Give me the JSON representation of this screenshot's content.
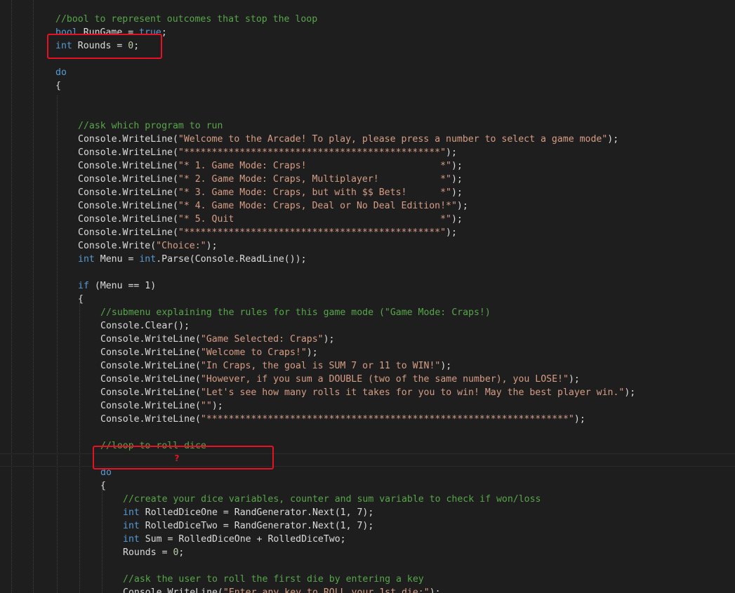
{
  "editor": {
    "theme": {
      "background": "#1e1e1e",
      "keyword": "#569cd6",
      "string": "#d69d85",
      "comment": "#57a64a",
      "number": "#b5cea8",
      "plain": "#dcdcdc",
      "highlight_box": "#e81123"
    },
    "lines": [
      [
        [
          "cm",
          "//bool to represent outcomes that stop the loop"
        ]
      ],
      [
        [
          "kw",
          "bool"
        ],
        [
          "pl",
          " RunGame = "
        ],
        [
          "kw",
          "true"
        ],
        [
          "pl",
          ";"
        ]
      ],
      [
        [
          "kw",
          "int"
        ],
        [
          "pl",
          " Rounds = "
        ],
        [
          "num",
          "0"
        ],
        [
          "pl",
          ";"
        ]
      ],
      [],
      [
        [
          "kw",
          "do"
        ]
      ],
      [
        [
          "pl",
          "{"
        ]
      ],
      [],
      [],
      [
        [
          "cm",
          "//ask which program to run"
        ]
      ],
      [
        [
          "pl",
          "Console.WriteLine("
        ],
        [
          "str",
          "\"Welcome to the Arcade! To play, please press a number to select a game mode\""
        ],
        [
          "pl",
          ");"
        ]
      ],
      [
        [
          "pl",
          "Console.WriteLine("
        ],
        [
          "str",
          "\"**********************************************\""
        ],
        [
          "pl",
          ");"
        ]
      ],
      [
        [
          "pl",
          "Console.WriteLine("
        ],
        [
          "str",
          "\"* 1. Game Mode: Craps!                        *\""
        ],
        [
          "pl",
          ");"
        ]
      ],
      [
        [
          "pl",
          "Console.WriteLine("
        ],
        [
          "str",
          "\"* 2. Game Mode: Craps, Multiplayer!           *\""
        ],
        [
          "pl",
          ");"
        ]
      ],
      [
        [
          "pl",
          "Console.WriteLine("
        ],
        [
          "str",
          "\"* 3. Game Mode: Craps, but with $$ Bets!      *\""
        ],
        [
          "pl",
          ");"
        ]
      ],
      [
        [
          "pl",
          "Console.WriteLine("
        ],
        [
          "str",
          "\"* 4. Game Mode: Craps, Deal or No Deal Edition!*\""
        ],
        [
          "pl",
          ");"
        ]
      ],
      [
        [
          "pl",
          "Console.WriteLine("
        ],
        [
          "str",
          "\"* 5. Quit                                     *\""
        ],
        [
          "pl",
          ");"
        ]
      ],
      [
        [
          "pl",
          "Console.WriteLine("
        ],
        [
          "str",
          "\"**********************************************\""
        ],
        [
          "pl",
          ");"
        ]
      ],
      [
        [
          "pl",
          "Console.Write("
        ],
        [
          "str",
          "\"Choice:\""
        ],
        [
          "pl",
          ");"
        ]
      ],
      [
        [
          "kw",
          "int"
        ],
        [
          "pl",
          " Menu = "
        ],
        [
          "kw",
          "int"
        ],
        [
          "pl",
          ".Parse(Console.ReadLine());"
        ]
      ],
      [],
      [
        [
          "kw",
          "if"
        ],
        [
          "pl",
          " (Menu == 1)"
        ]
      ],
      [
        [
          "pl",
          "{"
        ]
      ],
      [
        [
          "cm",
          "//submenu explaining the rules for this game mode (\"Game Mode: Craps!)"
        ]
      ],
      [
        [
          "pl",
          "Console.Clear();"
        ]
      ],
      [
        [
          "pl",
          "Console.WriteLine("
        ],
        [
          "str",
          "\"Game Selected: Craps\""
        ],
        [
          "pl",
          ");"
        ]
      ],
      [
        [
          "pl",
          "Console.WriteLine("
        ],
        [
          "str",
          "\"Welcome to Craps!\""
        ],
        [
          "pl",
          ");"
        ]
      ],
      [
        [
          "pl",
          "Console.WriteLine("
        ],
        [
          "str",
          "\"In Craps, the goal is SUM 7 or 11 to WIN!\""
        ],
        [
          "pl",
          ");"
        ]
      ],
      [
        [
          "pl",
          "Console.WriteLine("
        ],
        [
          "str",
          "\"However, if you sum a DOUBLE (two of the same number), you LOSE!\""
        ],
        [
          "pl",
          ");"
        ]
      ],
      [
        [
          "pl",
          "Console.WriteLine("
        ],
        [
          "str",
          "\"Let's see how many rolls it takes for you to win! May the best player win.\""
        ],
        [
          "pl",
          ");"
        ]
      ],
      [
        [
          "pl",
          "Console.WriteLine("
        ],
        [
          "str",
          "\"\""
        ],
        [
          "pl",
          ");"
        ]
      ],
      [
        [
          "pl",
          "Console.WriteLine("
        ],
        [
          "str",
          "\"*****************************************************************\""
        ],
        [
          "pl",
          ");"
        ]
      ],
      [],
      [
        [
          "cm",
          "//loop to roll dice"
        ]
      ],
      [],
      [
        [
          "kw",
          "do"
        ]
      ],
      [
        [
          "pl",
          "{"
        ]
      ],
      [
        [
          "cm",
          "//create your dice variables, counter and sum variable to check if won/loss"
        ]
      ],
      [
        [
          "kw",
          "int"
        ],
        [
          "pl",
          " RolledDiceOne = RandGenerator.Next(1, 7);"
        ]
      ],
      [
        [
          "kw",
          "int"
        ],
        [
          "pl",
          " RolledDiceTwo = RandGenerator.Next(1, 7);"
        ]
      ],
      [
        [
          "kw",
          "int"
        ],
        [
          "pl",
          " Sum = RolledDiceOne + RolledDiceTwo;"
        ]
      ],
      [
        [
          "pl",
          "Rounds = "
        ],
        [
          "num",
          "0"
        ],
        [
          "pl",
          ";"
        ]
      ],
      [],
      [
        [
          "cm",
          "//ask the user to roll the first die by entering a key"
        ]
      ],
      [
        [
          "pl",
          "Console.WriteLine("
        ],
        [
          "str",
          "\"Enter any key to ROLL your 1st die:\""
        ],
        [
          "pl",
          ");"
        ]
      ]
    ],
    "cursor_marker": "?"
  }
}
